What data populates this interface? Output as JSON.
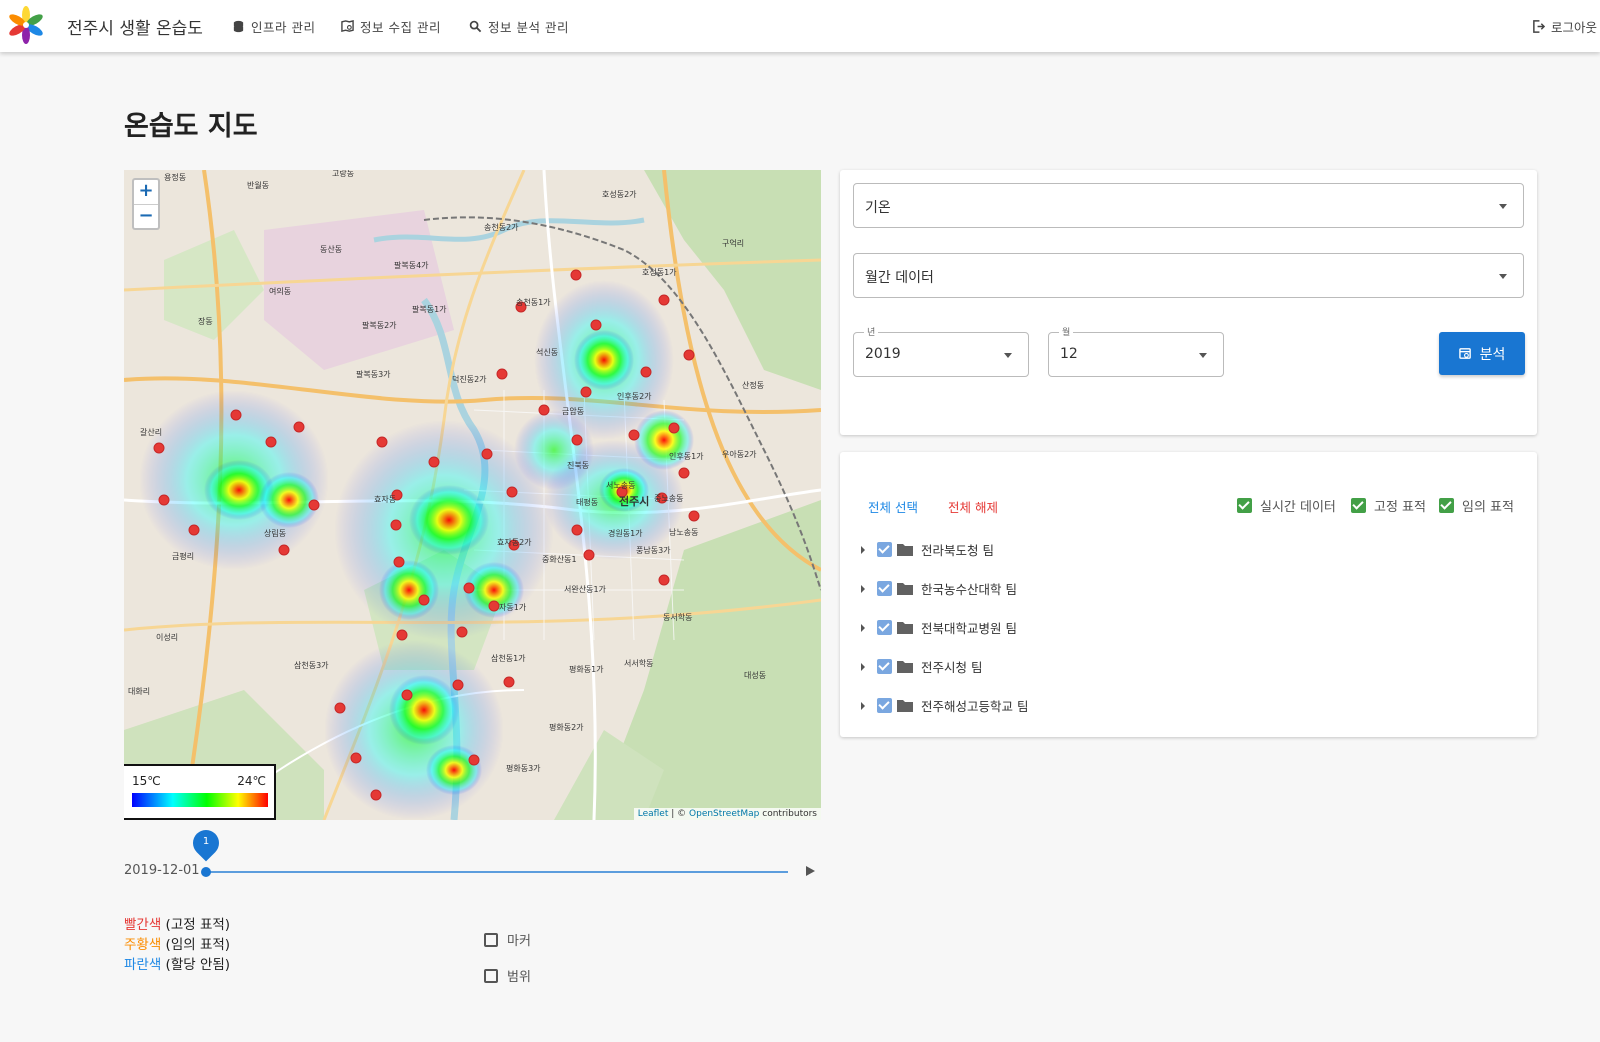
{
  "app": {
    "title": "전주시 생활 온습도",
    "logo_colors": [
      "#e53935",
      "#fdd835",
      "#43a047",
      "#1e88e5",
      "#8e24aa",
      "#fb8c00"
    ]
  },
  "nav": {
    "items": [
      {
        "label": "인프라 관리",
        "icon": "database-icon"
      },
      {
        "label": "정보 수집 관리",
        "icon": "map-search-icon"
      },
      {
        "label": "정보 분석 관리",
        "icon": "search-icon"
      }
    ],
    "logout": "로그아웃"
  },
  "page": {
    "title": "온습도 지도"
  },
  "map": {
    "zoom_in": "+",
    "zoom_out": "−",
    "legend": {
      "min": "15℃",
      "max": "24℃"
    },
    "attribution": {
      "leaflet": "Leaflet",
      "sep": " | © ",
      "osm": "OpenStreetMap",
      "suffix": " contributors"
    },
    "place_labels": [
      "용정동",
      "반월동",
      "고랑동",
      "동산동",
      "팔복동4가",
      "여의동",
      "팔복동1가",
      "팔복동2가",
      "장동",
      "팔복동3가",
      "덕진동2가",
      "송천동2가",
      "호성동2가",
      "구억리",
      "호성동1가",
      "송천동1가",
      "인후동2가",
      "산정동",
      "인후동1가",
      "우아동2가",
      "중노송동",
      "전주시",
      "남노송동",
      "서노송동",
      "갈산리",
      "효자동",
      "중화산동1",
      "서완산동1가",
      "자동1가",
      "삼천동1가",
      "평화동1가",
      "서서학동",
      "동서학동",
      "삼천동3가",
      "이성리",
      "대화리",
      "평화동2가",
      "평화동3가",
      "진북동",
      "금암동",
      "풍남동3가",
      "경원동1가",
      "태평동",
      "효자동2가",
      "상림동",
      "금평리",
      "석신동",
      "송천동"
    ]
  },
  "timeline": {
    "date": "2019-12-01",
    "step": "1"
  },
  "legend_text": [
    {
      "color_word": "빨간색",
      "color": "#e53935",
      "rest": " (고정 표적)"
    },
    {
      "color_word": "주황색",
      "color": "#fb8c00",
      "rest": " (임의 표적)"
    },
    {
      "color_word": "파란색",
      "color": "#1e88e5",
      "rest": " (할당 안됨)"
    }
  ],
  "layer_toggles": {
    "marker": "마커",
    "range": "범위"
  },
  "controls": {
    "variable": "기온",
    "period": "월간 데이터",
    "year_label": "년",
    "year": "2019",
    "month_label": "월",
    "month": "12",
    "analyze": "분석"
  },
  "tree": {
    "select_all": "전체 선택",
    "deselect_all": "전체 해제",
    "filters": [
      "실시간 데이터",
      "고정 표적",
      "임의 표적"
    ],
    "teams": [
      "전라북도청 팀",
      "한국농수산대학 팀",
      "전북대학교병원 팀",
      "전주시청 팀",
      "전주해성고등학교 팀"
    ]
  }
}
